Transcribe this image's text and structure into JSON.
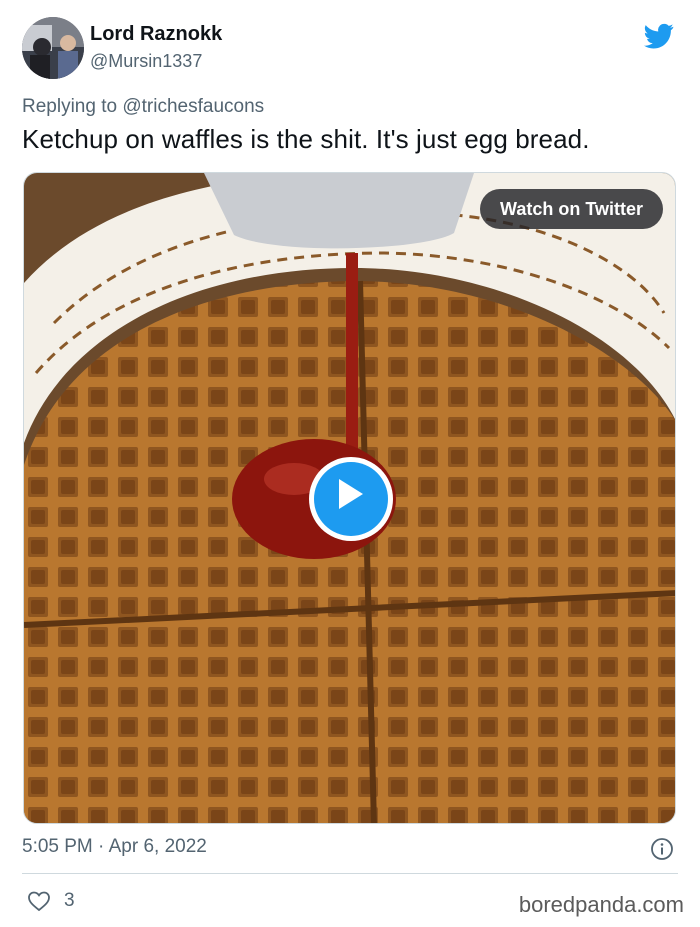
{
  "author": {
    "name": "Lord Raznokk",
    "handle": "@Mursin1337"
  },
  "reply": {
    "prefix": "Replying to",
    "mention": "@trichesfaucons"
  },
  "tweet": {
    "text": "Ketchup on waffles is the shit. It's just egg bread."
  },
  "media": {
    "watch_label": "Watch on Twitter"
  },
  "meta": {
    "time": "5:05 PM",
    "separator": "·",
    "date": "Apr 6, 2022"
  },
  "actions": {
    "like_count": "3"
  },
  "watermark": "boredpanda.com",
  "icons": {
    "brand": "twitter-bird-icon",
    "info": "info-icon",
    "like": "heart-icon",
    "play": "play-icon"
  },
  "colors": {
    "accent": "#1d9bf0",
    "text": "#0f1419",
    "secondary": "#536471",
    "border": "#cfd9de"
  }
}
